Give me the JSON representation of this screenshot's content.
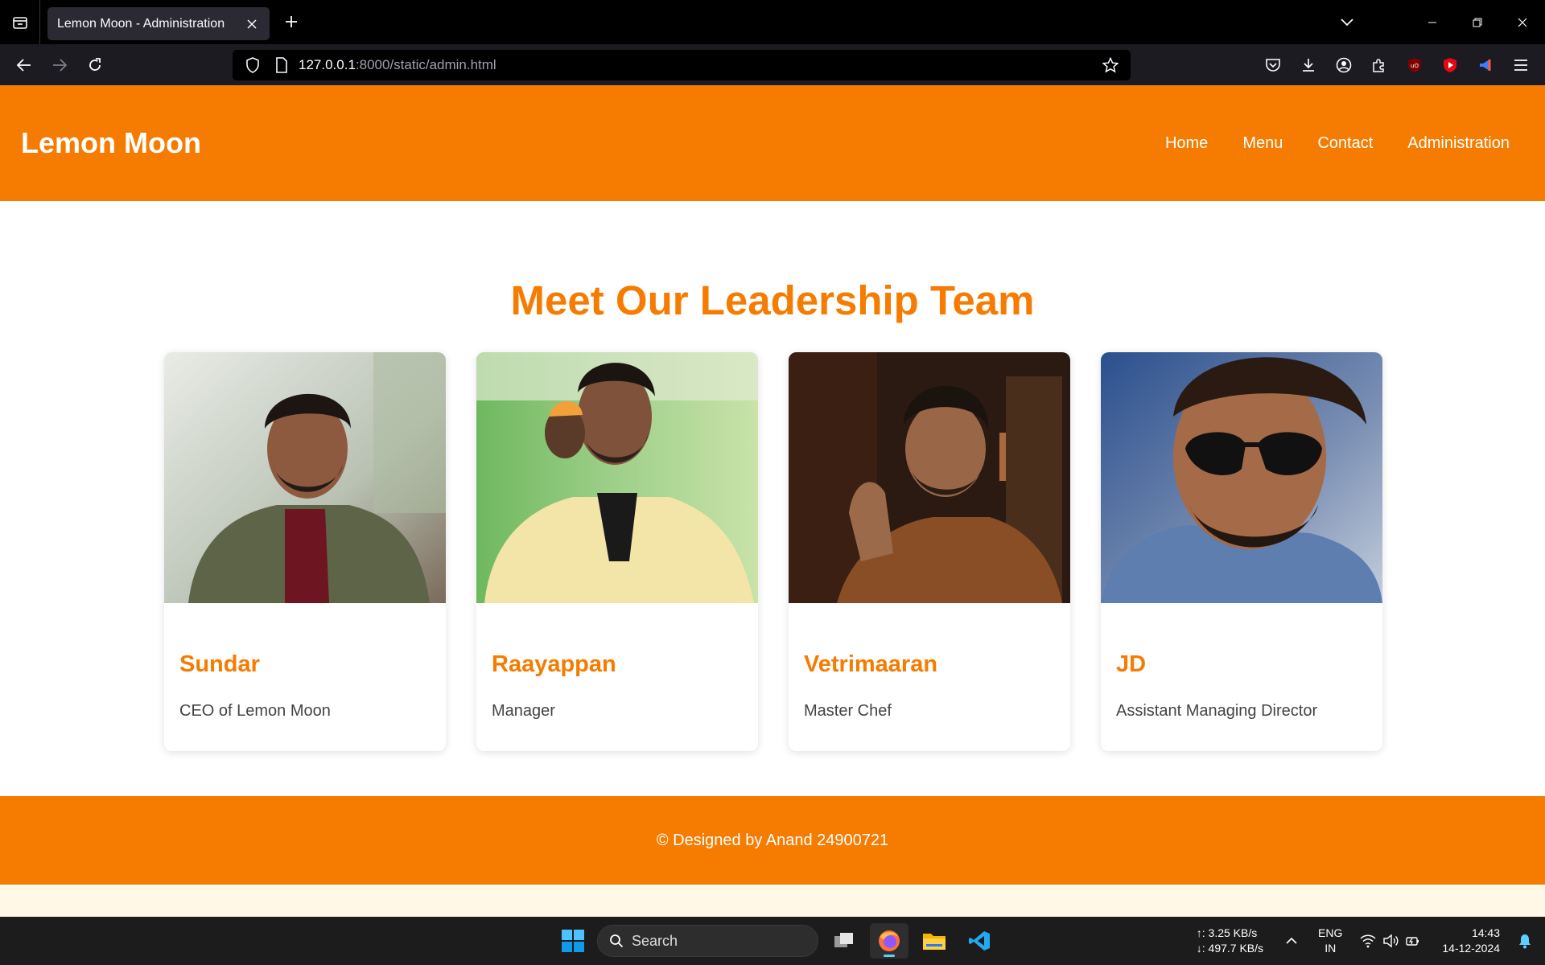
{
  "browser": {
    "tab_title": "Lemon Moon - Administration",
    "url_host": "127.0.0.1",
    "url_path": ":8000/static/admin.html"
  },
  "site": {
    "logo": "Lemon Moon",
    "nav": [
      "Home",
      "Menu",
      "Contact",
      "Administration"
    ],
    "heading": "Meet Our Leadership Team",
    "team": [
      {
        "name": "Sundar",
        "role": "CEO of Lemon Moon"
      },
      {
        "name": "Raayappan",
        "role": "Manager"
      },
      {
        "name": "Vetrimaaran",
        "role": "Master Chef"
      },
      {
        "name": "JD",
        "role": "Assistant Managing Director"
      }
    ],
    "footer": "© Designed by Anand 24900721"
  },
  "taskbar": {
    "search_placeholder": "Search",
    "net_up": "↑: 3.25 KB/s",
    "net_down": "↓: 497.7 KB/s",
    "lang_1": "ENG",
    "lang_2": "IN",
    "time": "14:43",
    "date": "14-12-2024"
  },
  "colors": {
    "brand": "#f57c00",
    "page_bg": "#fff8e6"
  }
}
